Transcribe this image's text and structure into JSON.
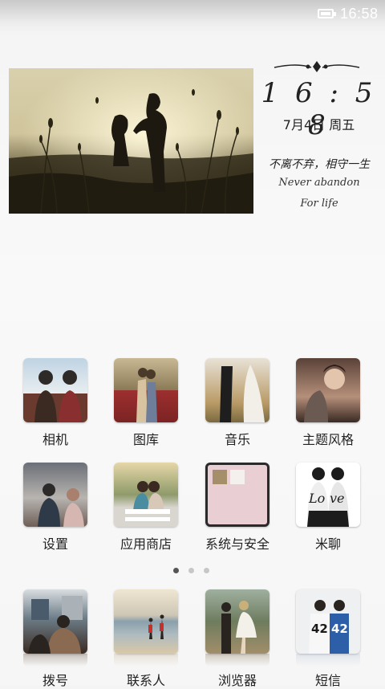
{
  "status_bar": {
    "time": "16:58",
    "battery_icon": "battery-icon"
  },
  "clock_widget": {
    "time": "1 6 : 5 8",
    "date": "7月4日 周五",
    "motto_cn": "不离不弃，相守一生",
    "motto_en_line1": "Never abandon",
    "motto_en_line2": "For life"
  },
  "apps": [
    {
      "label": "相机"
    },
    {
      "label": "图库"
    },
    {
      "label": "音乐"
    },
    {
      "label": "主题风格"
    },
    {
      "label": "设置"
    },
    {
      "label": "应用商店"
    },
    {
      "label": "系统与安全"
    },
    {
      "label": "米聊"
    }
  ],
  "page_indicator": {
    "pages": 3,
    "current": 1
  },
  "dock": [
    {
      "label": "拨号"
    },
    {
      "label": "联系人"
    },
    {
      "label": "浏览器"
    },
    {
      "label": "短信"
    }
  ],
  "tile_texts": {
    "love_left": "Lo",
    "love_right": "ve",
    "jersey_left": "42",
    "jersey_right": "42"
  }
}
